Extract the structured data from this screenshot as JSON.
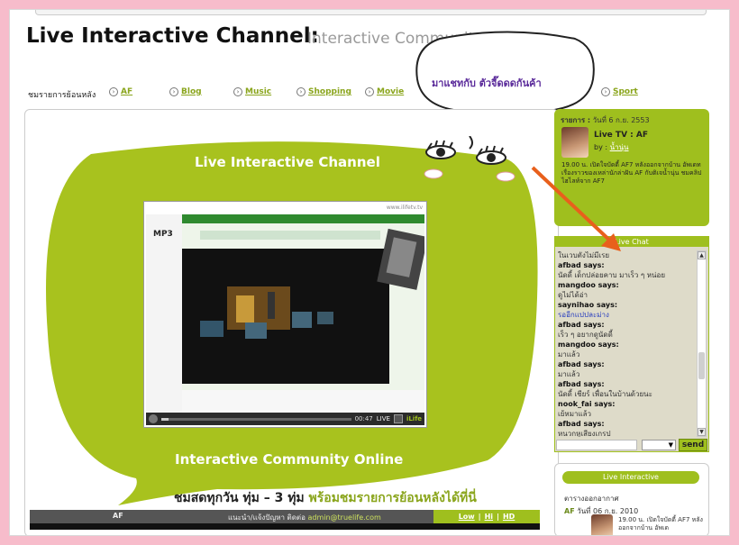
{
  "header": {
    "title": "Live Interactive Channel:",
    "subtitle": "Interactive Community Online"
  },
  "nav": {
    "label": "ชมรายการย้อนหลัง",
    "items": [
      "AF",
      "Blog",
      "Music",
      "Shopping",
      "Movie",
      "Sport"
    ]
  },
  "speech_bubble": {
    "text": "มาแชทกับ ตัวจี๊ดดดกันค้า"
  },
  "main": {
    "bubble_title": "Live Interactive Channel",
    "bubble_subtitle": "Interactive Community Online",
    "tagline_dark": "ชมสดทุกวัน ทุ่ม – 3 ทุ่ม",
    "tagline_green": "พร้อมชมรายการย้อนหลังได้ที่นี่",
    "player": {
      "url": "www.ilifetv.tv",
      "time": "00:47",
      "live": "LIVE"
    },
    "footer": {
      "left": "AF",
      "mid": "แนะนำ/แจ้งปัญหา ติดต่อ",
      "email": "admin@truelife.com",
      "links": [
        "Low",
        "Hi",
        "HD"
      ]
    }
  },
  "program": {
    "date_label": "รายการ :",
    "date": "วันที่ 6 ก.ย. 2553",
    "name": "Live TV : AF",
    "by_label": "by :",
    "by": "น้ำนุ่น",
    "desc": "19.00 น. เปิดใจบัดดี้ AF7 หลังออกจากบ้าน อัพเดทเรื่องราวของเหล่านักล่าฝัน AF กับติเจน้ำนุ่น ชมคลิปไฮไลท์จาก AF7"
  },
  "chat": {
    "header": "Live Chat",
    "send": "send",
    "messages": [
      {
        "user": "",
        "text": "ในเวบตังไม่มีเรย"
      },
      {
        "user": "afbad says:",
        "text": "นัดดี้ เด็กปล่อยคาบ มาเร็ว ๆ หน่อย"
      },
      {
        "user": "mangdoo says:",
        "text": "ดูไม่ได้อ่า"
      },
      {
        "user": "saynihao says:",
        "text": "รออีกแปปละม่าง",
        "blue": true
      },
      {
        "user": "afbad says:",
        "text": "เร็ว ๆ อยากดูนัดดี้"
      },
      {
        "user": "mangdoo says:",
        "text": "มาแล้ว"
      },
      {
        "user": "afbad says:",
        "text": "มาแล้ว"
      },
      {
        "user": "afbad says:",
        "text": "นัดดี้ เชียร์ เพื่อนในบ้านด้วยนะ"
      },
      {
        "user": "nook_fai says:",
        "text": "เย้หมาแล้ว"
      },
      {
        "user": "afbad says:",
        "text": "หนวกหูเสียงเกรป"
      }
    ]
  },
  "interactive": {
    "header": "Live Interactive",
    "schedule_title": "ตารางออกอากาศ",
    "item_name": "AF",
    "item_date": "วันที่ 06 ก.ย. 2010",
    "item_desc": "19.00 น. เปิดใจบัดดี้ AF7 หลังออกจากบ้าน อัพเด"
  },
  "colors": {
    "accent_green": "#9fbf1e",
    "page_border": "#f7bccb",
    "speech_text": "#5a2a9a",
    "arrow": "#e8601c"
  }
}
